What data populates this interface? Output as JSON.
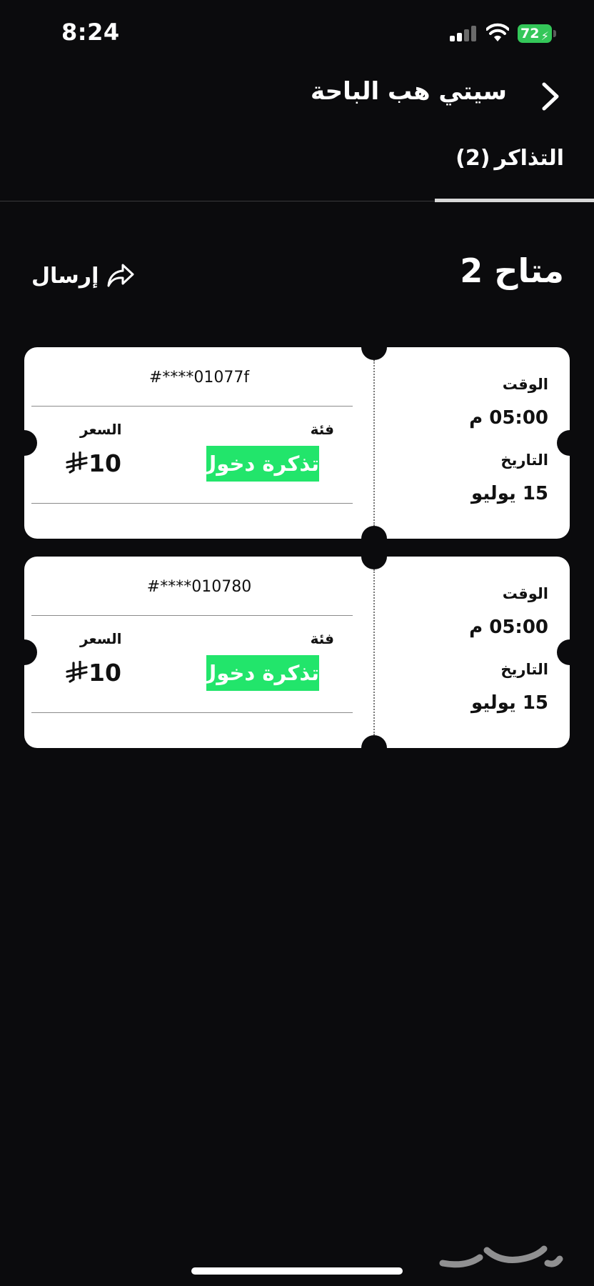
{
  "status_bar": {
    "time": "8:24",
    "battery_level": "72",
    "battery_color": "#34c759"
  },
  "header": {
    "title": "سيتي هب الباحة",
    "back_icon": "chevron-right-icon"
  },
  "tabs": [
    {
      "label": "التذاكر",
      "count": "(2)",
      "active": true
    }
  ],
  "summary": {
    "available": "متاح 2",
    "send_label": "إرسال",
    "send_icon": "share-forward-icon"
  },
  "tickets": [
    {
      "code": "#****01077f",
      "time_label": "الوقت",
      "time_value": "05:00 م",
      "date_label": "التاريخ",
      "date_value": "15 يوليو",
      "category_label": "فئة",
      "category_value": "تذكرة دخول",
      "price_label": "السعر",
      "price_value": "10",
      "currency_icon": "saudi-riyal-icon"
    },
    {
      "code": "#****010780",
      "time_label": "الوقت",
      "time_value": "05:00 م",
      "date_label": "التاريخ",
      "date_value": "15 يوليو",
      "category_label": "فئة",
      "category_value": "تذكرة دخول",
      "price_label": "السعر",
      "price_value": "10",
      "currency_icon": "saudi-riyal-icon"
    }
  ],
  "colors": {
    "background": "#0b0b0d",
    "ticket": "#ffffff",
    "category_badge": "#22e56b"
  }
}
